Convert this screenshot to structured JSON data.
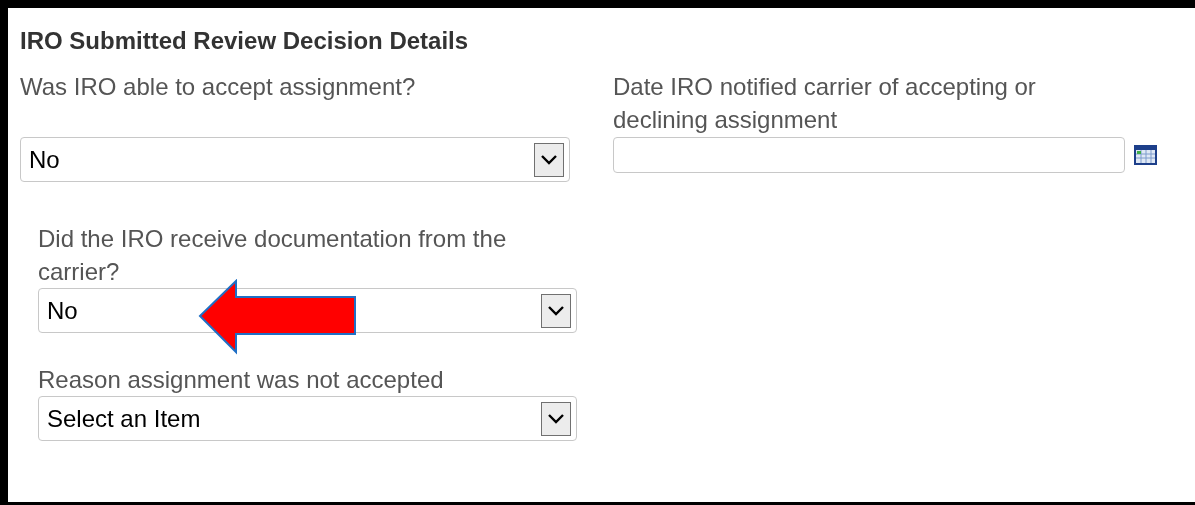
{
  "heading": "IRO Submitted Review Decision Details",
  "fields": [
    {
      "kind": "select",
      "label": "Was IRO able to accept assignment?",
      "value": "No"
    },
    {
      "kind": "date",
      "label": "Date IRO notified carrier of accepting or declining assignment"
    }
  ],
  "sub_fields": [
    {
      "kind": "select",
      "label": "Did the IRO receive documentation from the carrier?",
      "value": "No",
      "arrow": true
    },
    {
      "kind": "select",
      "label": "Reason assignment was not accepted",
      "value": "Select an Item",
      "arrow": false
    }
  ]
}
